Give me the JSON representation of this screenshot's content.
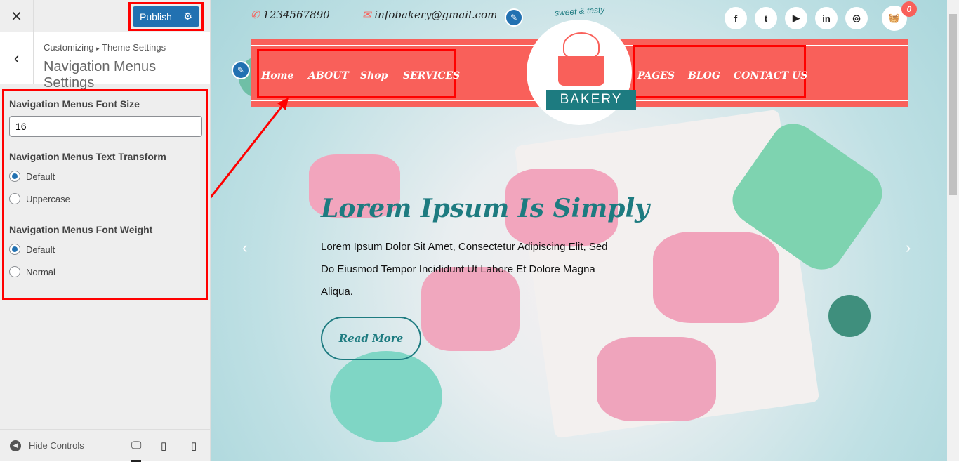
{
  "sidebar": {
    "close_icon": "close-icon",
    "publish_label": "Publish",
    "settings_icon": "gear-icon",
    "breadcrumb_root": "Customizing",
    "breadcrumb_sep": "▸",
    "breadcrumb_section": "Theme Settings",
    "title": "Navigation Menus Settings",
    "font_size": {
      "label": "Navigation Menus Font Size",
      "value": "16"
    },
    "text_transform": {
      "label": "Navigation Menus Text Transform",
      "options": [
        "Default",
        "Uppercase"
      ],
      "selected": "Default"
    },
    "font_weight": {
      "label": "Navigation Menus Font Weight",
      "options": [
        "Default",
        "Normal"
      ],
      "selected": "Default"
    },
    "hide_controls": "Hide Controls",
    "devices": [
      "desktop",
      "tablet",
      "mobile"
    ]
  },
  "preview": {
    "phone": "1234567890",
    "email": "infobakery@gmail.com",
    "logo_tagline": "sweet & tasty",
    "logo_name": "BAKERY",
    "cart_count": "0",
    "social": [
      "f",
      "t",
      "▶",
      "in",
      "◎"
    ],
    "nav_left": [
      "Home",
      "ABOUT",
      "Shop",
      "SERVICES"
    ],
    "nav_right": [
      "PAGES",
      "BLOG",
      "CONTACT US"
    ],
    "hero_title": "Lorem Ipsum Is Simply",
    "hero_text": "Lorem Ipsum Dolor Sit Amet, Consectetur Adipiscing Elit, Sed Do Eiusmod Tempor Incididunt Ut Labore Et Dolore Magna Aliqua.",
    "read_more": "Read More"
  },
  "colors": {
    "accent": "#2271b1",
    "brand": "#f9605a",
    "teal": "#1d7b80",
    "highlight": "#ff0000"
  }
}
